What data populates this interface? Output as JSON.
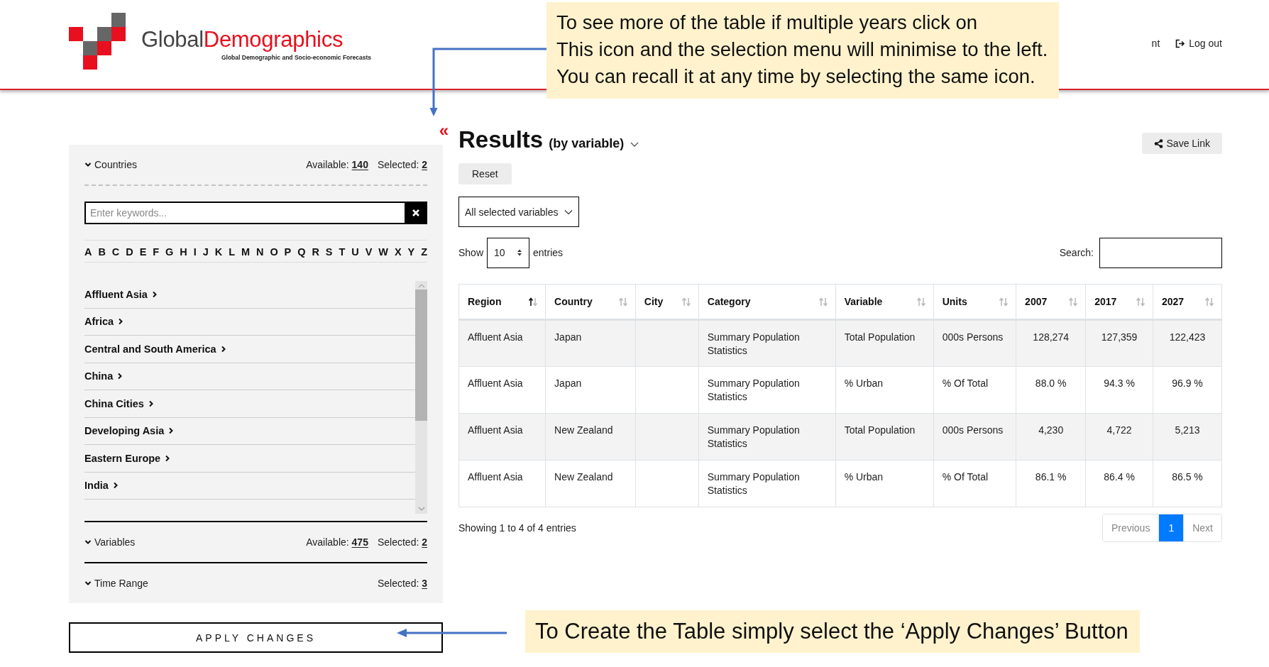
{
  "header": {
    "logo": {
      "word_1": "Global",
      "word_2": "Demographics",
      "tagline": "Global Demographic and Socio-economic Forecasts"
    },
    "nav": [
      {
        "kind": "link",
        "label": "nt"
      },
      {
        "kind": "logout",
        "label": "Log out"
      }
    ]
  },
  "sidebar": {
    "collapse_icon": "«",
    "sections": [
      {
        "title": "Countries",
        "available_label": "Available:",
        "available": "140",
        "selected_label": "Selected:",
        "selected": "2",
        "search": {
          "placeholder": "Enter keywords..."
        },
        "letters": [
          "A",
          "B",
          "C",
          "D",
          "E",
          "F",
          "G",
          "H",
          "I",
          "J",
          "K",
          "L",
          "M",
          "N",
          "O",
          "P",
          "Q",
          "R",
          "S",
          "T",
          "U",
          "V",
          "W",
          "X",
          "Y",
          "Z"
        ],
        "regions": [
          "Affluent Asia",
          "Africa",
          "Central and South America",
          "China",
          "China Cities",
          "Developing Asia",
          "Eastern Europe",
          "India"
        ]
      },
      {
        "title": "Variables",
        "available_label": "Available:",
        "available": "475",
        "selected_label": "Selected:",
        "selected": "2"
      },
      {
        "title": "Time Range",
        "selected_label": "Selected:",
        "selected": "3"
      }
    ],
    "apply_button": "APPLY CHANGES"
  },
  "results": {
    "title": "Results",
    "subtitle": "(by variable)",
    "save_link": "Save Link",
    "reset": "Reset",
    "variable_filter": "All selected variables",
    "show_label": "Show",
    "page_length": "10",
    "entries_label": "entries",
    "search_label": "Search:",
    "table": {
      "columns": [
        {
          "label": "Region",
          "sorted": true,
          "kind": "text"
        },
        {
          "label": "Country",
          "sorted": false,
          "kind": "text"
        },
        {
          "label": "City",
          "sorted": false,
          "kind": "text"
        },
        {
          "label": "Category",
          "sorted": false,
          "kind": "text"
        },
        {
          "label": "Variable",
          "sorted": false,
          "kind": "text"
        },
        {
          "label": "Units",
          "sorted": false,
          "kind": "text"
        },
        {
          "label": "2007",
          "sorted": false,
          "kind": "number"
        },
        {
          "label": "2017",
          "sorted": false,
          "kind": "number"
        },
        {
          "label": "2027",
          "sorted": false,
          "kind": "number"
        }
      ],
      "rows": [
        [
          "Affluent Asia",
          "Japan",
          "",
          "Summary Population Statistics",
          "Total Population",
          "000s Persons",
          "128,274",
          "127,359",
          "122,423"
        ],
        [
          "Affluent Asia",
          "Japan",
          "",
          "Summary Population Statistics",
          "% Urban",
          "% Of Total",
          "88.0 %",
          "94.3 %",
          "96.9 %"
        ],
        [
          "Affluent Asia",
          "New Zealand",
          "",
          "Summary Population Statistics",
          "Total Population",
          "000s Persons",
          "4,230",
          "4,722",
          "5,213"
        ],
        [
          "Affluent Asia",
          "New Zealand",
          "",
          "Summary Population Statistics",
          "% Urban",
          "% Of Total",
          "86.1 %",
          "86.4 %",
          "86.5 %"
        ]
      ]
    },
    "info": "Showing 1 to 4 of 4 entries",
    "pagination": [
      {
        "label": "Previous",
        "selected": false,
        "disabled": true
      },
      {
        "label": "1",
        "selected": true,
        "disabled": false
      },
      {
        "label": "Next",
        "selected": false,
        "disabled": true
      }
    ]
  },
  "callouts": [
    {
      "lines": [
        "To see more of the table if multiple years click on",
        "This icon and the selection menu will minimise to the left.",
        "You can recall it at any time by selecting the same icon."
      ]
    },
    {
      "lines": [
        "To Create the Table simply select the ‘Apply Changes’ Button"
      ]
    }
  ]
}
